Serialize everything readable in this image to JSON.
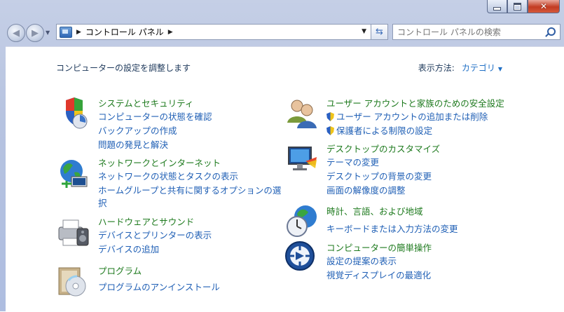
{
  "window": {
    "minimize_label": "",
    "maximize_label": "",
    "close_label": "✕"
  },
  "address": {
    "root_label": "コントロール パネル"
  },
  "search": {
    "placeholder": "コントロール パネルの検索"
  },
  "main": {
    "heading": "コンピューターの設定を調整します",
    "view_by_label": "表示方法:",
    "view_by_value": "カテゴリ"
  },
  "categories_left": [
    {
      "title": "システムとセキュリティ",
      "icon": "shield-icon",
      "links": [
        "コンピューターの状態を確認",
        "バックアップの作成",
        "問題の発見と解決"
      ]
    },
    {
      "title": "ネットワークとインターネット",
      "icon": "network-globe-icon",
      "links": [
        "ネットワークの状態とタスクの表示",
        "ホームグループと共有に関するオプションの選",
        "択"
      ]
    },
    {
      "title": "ハードウェアとサウンド",
      "icon": "printer-icon",
      "links": [
        "デバイスとプリンターの表示",
        "デバイスの追加"
      ]
    },
    {
      "title": "プログラム",
      "icon": "programs-cd-icon",
      "links": [
        "プログラムのアンインストール"
      ]
    }
  ],
  "categories_right": [
    {
      "title": "ユーザー アカウントと家族のための安全設定",
      "icon": "users-icon",
      "links": [
        "ユーザー アカウントの追加または削除",
        "保護者による制限の設定"
      ]
    },
    {
      "title": "デスクトップのカスタマイズ",
      "icon": "monitor-paint-icon",
      "links": [
        "テーマの変更",
        "デスクトップの背景の変更",
        "画面の解像度の調整"
      ]
    },
    {
      "title": "時計、言語、および地域",
      "icon": "clock-globe-icon",
      "links": [
        "キーボードまたは入力方法の変更"
      ]
    },
    {
      "title": "コンピューターの簡単操作",
      "icon": "ease-of-access-icon",
      "links": [
        "設定の提案の表示",
        "視覚ディスプレイの最適化"
      ]
    }
  ]
}
